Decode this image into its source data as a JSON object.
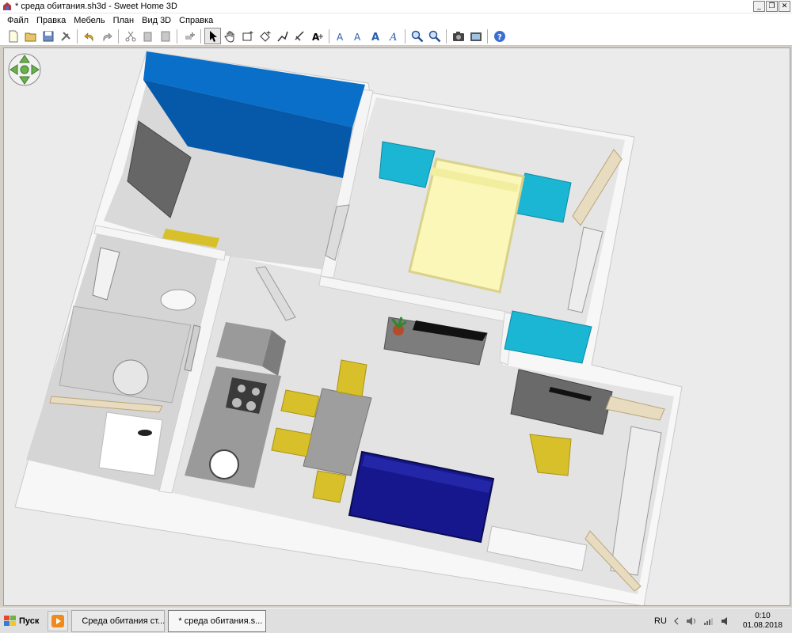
{
  "window": {
    "title": "* среда обитания.sh3d - Sweet Home 3D",
    "minimize_glyph": "_",
    "restore_glyph": "❐",
    "close_glyph": "✕"
  },
  "menu": [
    "Файл",
    "Правка",
    "Мебель",
    "План",
    "Вид 3D",
    "Справка"
  ],
  "toolbar": {
    "buttons": [
      "new-file-icon",
      "open-icon",
      "save-icon",
      "cut-icon",
      "undo-icon",
      "redo-icon",
      "cut-icon-2",
      "copy-icon",
      "paste-icon",
      "add-furniture-icon",
      "select-mode-icon",
      "pan-mode-icon",
      "create-walls-icon",
      "create-rooms-icon",
      "create-dimensions-icon",
      "create-polylines-icon",
      "create-labels-icon",
      "text-style-icon",
      "increase-text-icon",
      "decrease-text-icon",
      "bold-text-icon",
      "italic-text-icon",
      "zoom-in-icon",
      "zoom-out-icon",
      "create-photo-icon",
      "create-video-icon",
      "help-icon"
    ]
  },
  "view3d": {
    "navigator_icon": "navigation-arrows-icon"
  },
  "taskbar": {
    "start_label": "Пуск",
    "tasks": [
      {
        "label": "Среда обитания ст...",
        "icon": "yandex-browser-icon"
      },
      {
        "label": "* среда обитания.s...",
        "icon": "sweet-home-3d-icon"
      }
    ],
    "language": "RU",
    "time": "0:10",
    "date": "01.08.2018"
  },
  "colors": {
    "wall": "#f7f7f7",
    "floor": "#e0e0e0",
    "wardrobe": "#0a6fc9",
    "nightstand": "#1ab6d3",
    "bed": "#fbf7b9",
    "sofa": "#16178c",
    "chair": "#d8c02a",
    "countertop": "#9a9a9a"
  }
}
